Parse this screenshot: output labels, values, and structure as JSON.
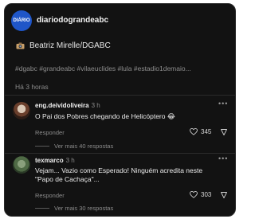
{
  "post": {
    "avatar_text": "DIÁRIO",
    "username": "diariodograndeabc",
    "photo_credit": "Beatriz Mirelle/DGABC",
    "hashtags": "#dgabc #grandeabc #vilaeuclides #lula #estadio1demaio...",
    "time": "Há 3 horas"
  },
  "comments": [
    {
      "username": "eng.deividoliveira",
      "time": "3 h",
      "text": "O Pai dos Pobres chegando de Helicóptero 😂",
      "reply_label": "Responder",
      "likes": "345",
      "view_more": "Ver mais 40 respostas",
      "more_icon": "ellipsis-icon"
    },
    {
      "username": "texmarco",
      "time": "3 h",
      "text_line1": "Vejam... Vazio como Esperado! Ninguém acredita neste",
      "text_line2": "\"Papo de Cachaça\"...",
      "reply_label": "Responder",
      "likes": "303",
      "view_more": "Ver mais 30 respostas",
      "more_icon": "ellipsis-icon"
    }
  ],
  "colors": {
    "background": "#121212",
    "text": "#f2f2f2",
    "muted": "#8c8c8c",
    "brand_blue": "#1f56c8"
  }
}
